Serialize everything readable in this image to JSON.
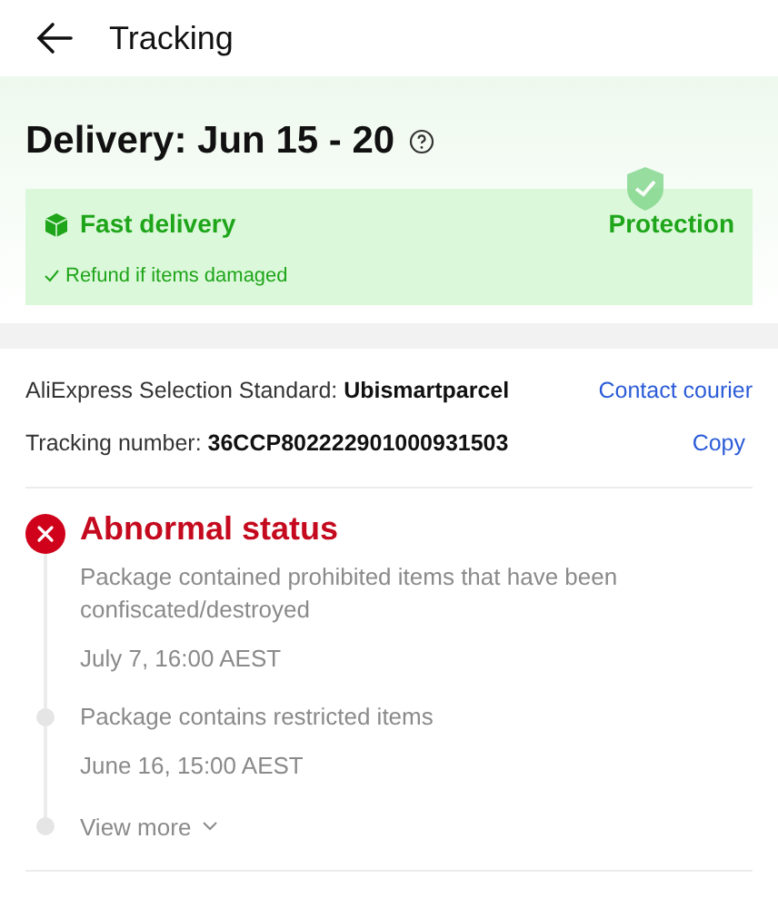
{
  "header": {
    "title": "Tracking"
  },
  "delivery": {
    "title": "Delivery: Jun 15 - 20",
    "fast_delivery": "Fast delivery",
    "refund_note": "Refund if items damaged",
    "protection": "Protection"
  },
  "shipping": {
    "carrier_label": "AliExpress Selection Standard: ",
    "carrier": "Ubismartparcel",
    "contact": "Contact courier",
    "tracking_label": "Tracking number: ",
    "tracking_number": "36CCP802222901000931503",
    "copy": "Copy"
  },
  "events": [
    {
      "kind": "abnormal",
      "title": "Abnormal status",
      "description": "Package contained prohibited items that have been confiscated/destroyed",
      "time": "July 7, 16:00 AEST"
    },
    {
      "kind": "normal",
      "description": "Package contains restricted items",
      "time": "June 16, 15:00 AEST"
    }
  ],
  "view_more": "View more"
}
